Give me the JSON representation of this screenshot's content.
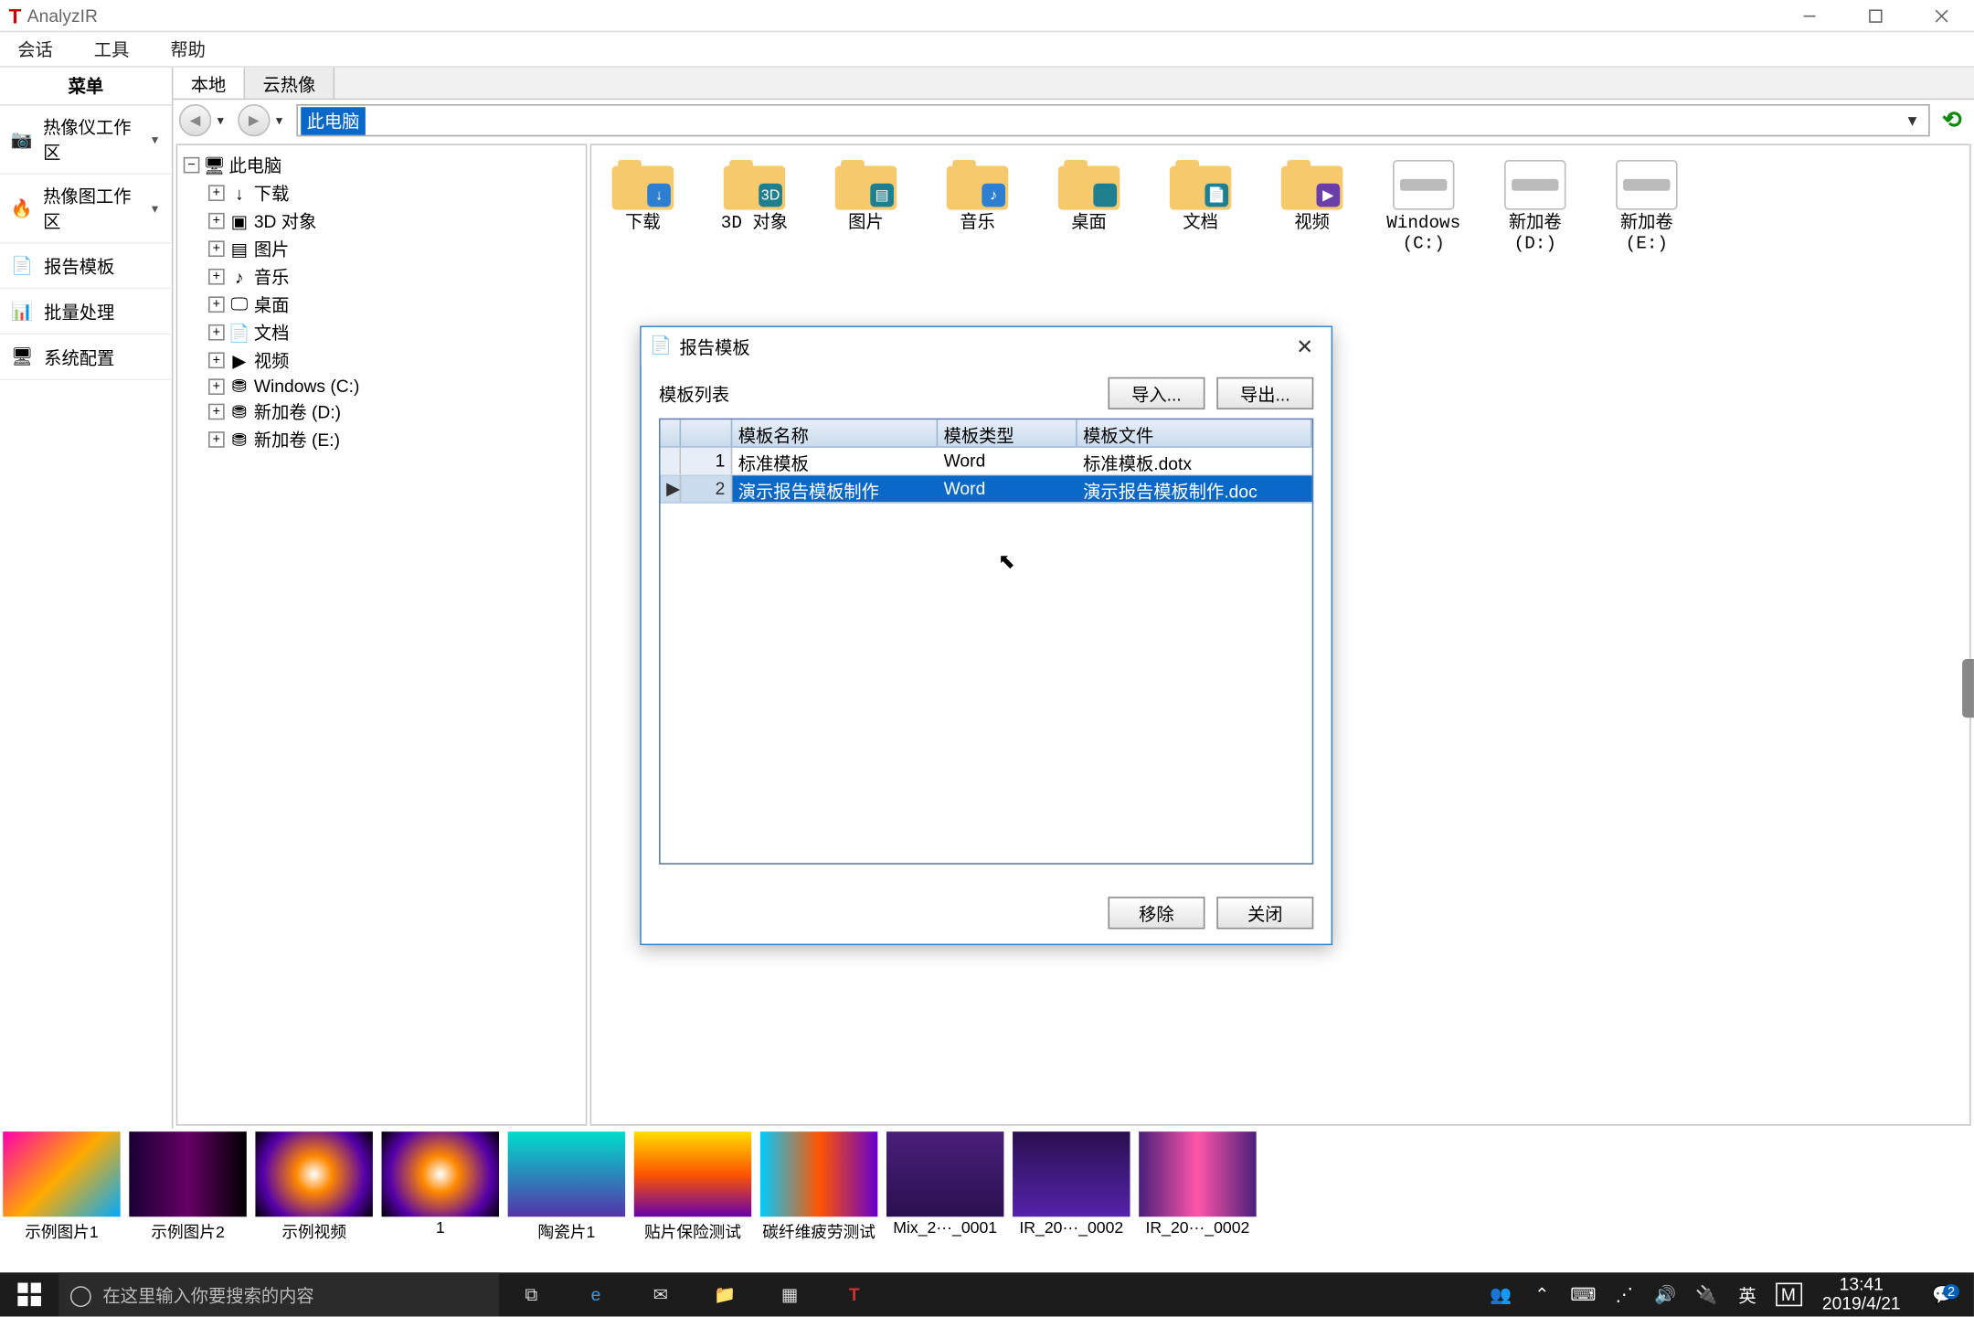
{
  "window": {
    "title": "AnalyzIR"
  },
  "menu": {
    "session": "会话",
    "tools": "工具",
    "help": "帮助"
  },
  "sidebar": {
    "header": "菜单",
    "items": [
      {
        "label": "热像仪工作区",
        "dd": true
      },
      {
        "label": "热像图工作区",
        "dd": true
      },
      {
        "label": "报告模板",
        "dd": false
      },
      {
        "label": "批量处理",
        "dd": false
      },
      {
        "label": "系统配置",
        "dd": false
      }
    ]
  },
  "tabs": {
    "local": "本地",
    "cloud": "云热像"
  },
  "address": {
    "text": "此电脑"
  },
  "tree": {
    "root": "此电脑",
    "nodes": [
      {
        "label": "下载",
        "icon": "↓"
      },
      {
        "label": "3D 对象",
        "icon": "▣"
      },
      {
        "label": "图片",
        "icon": "▤"
      },
      {
        "label": "音乐",
        "icon": "♪"
      },
      {
        "label": "桌面",
        "icon": "🖵"
      },
      {
        "label": "文档",
        "icon": "📄"
      },
      {
        "label": "视频",
        "icon": "▶"
      },
      {
        "label": "Windows (C:)",
        "icon": "⛃"
      },
      {
        "label": "新加卷 (D:)",
        "icon": "⛃"
      },
      {
        "label": "新加卷 (E:)",
        "icon": "⛃"
      }
    ]
  },
  "folders": [
    {
      "label": "下载",
      "badge": "↓",
      "bcls": "ic-blue"
    },
    {
      "label": "3D 对象",
      "badge": "3D",
      "bcls": "ic-teal"
    },
    {
      "label": "图片",
      "badge": "▤",
      "bcls": "ic-teal"
    },
    {
      "label": "音乐",
      "badge": "♪",
      "bcls": "ic-blue"
    },
    {
      "label": "桌面",
      "badge": "",
      "bcls": "ic-teal"
    },
    {
      "label": "文档",
      "badge": "📄",
      "bcls": "ic-teal"
    },
    {
      "label": "视频",
      "badge": "▶",
      "bcls": "ic-purple"
    },
    {
      "label": "Windows (C:)",
      "drive": true,
      "bcls": "ic-win"
    },
    {
      "label": "新加卷 (D:)",
      "drive": true
    },
    {
      "label": "新加卷 (E:)",
      "drive": true
    }
  ],
  "dialog": {
    "title": "报告模板",
    "list_label": "模板列表",
    "import": "导入...",
    "export": "导出...",
    "remove": "移除",
    "close": "关闭",
    "cols": {
      "name": "模板名称",
      "type": "模板类型",
      "file": "模板文件"
    },
    "rows": [
      {
        "idx": "1",
        "name": "标准模板",
        "type": "Word",
        "file": "标准模板.dotx"
      },
      {
        "idx": "2",
        "name": "演示报告模板制作",
        "type": "Word",
        "file": "演示报告模板制作.doc"
      }
    ]
  },
  "thumbs": [
    {
      "label": "示例图片1",
      "cls": "g1"
    },
    {
      "label": "示例图片2",
      "cls": "g2"
    },
    {
      "label": "示例视频",
      "cls": "g3"
    },
    {
      "label": "1",
      "cls": "g3"
    },
    {
      "label": "陶瓷片1",
      "cls": "g4"
    },
    {
      "label": "贴片保险测试",
      "cls": "g5"
    },
    {
      "label": "碳纤维疲劳测试",
      "cls": "g6"
    },
    {
      "label": "Mix_2···_0001",
      "cls": "g7"
    },
    {
      "label": "IR_20···_0002",
      "cls": "g8"
    },
    {
      "label": "IR_20···_0002",
      "cls": "g9"
    }
  ],
  "taskbar": {
    "search_placeholder": "在这里输入你要搜索的内容",
    "ime": "英",
    "ime2": "M",
    "time": "13:41",
    "date": "2019/4/21",
    "notif_count": "2"
  }
}
